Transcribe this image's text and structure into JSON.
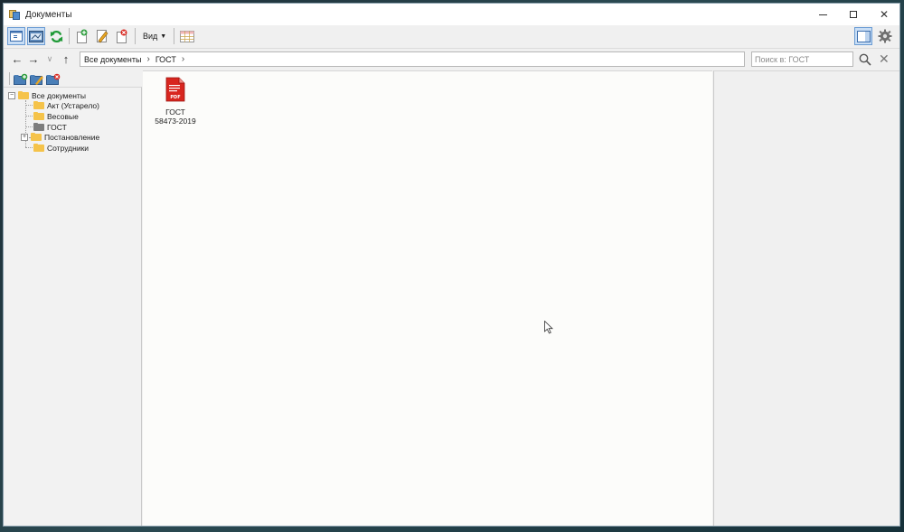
{
  "window": {
    "title": "Документы",
    "controls": {
      "minimize": "—",
      "maximize": "☐",
      "close": "✕"
    }
  },
  "toolbar": {
    "view_label": "Вид",
    "buttons": [
      "panel-toggle-icon",
      "view-layout-icon",
      "refresh-icon",
      "add-document-icon",
      "edit-icon",
      "delete-document-icon"
    ],
    "right_buttons": [
      "preview-pane-icon",
      "settings-gear-icon"
    ]
  },
  "address": {
    "breadcrumb": [
      "Все документы",
      "ГОСТ"
    ],
    "separator": "›",
    "search_placeholder": "Поиск в: ГОСТ"
  },
  "tree": {
    "root": "Все документы",
    "items": [
      {
        "label": "Акт (Устарело)",
        "color": "#f5c34a",
        "expandable": false
      },
      {
        "label": "Весовые",
        "color": "#f5c34a",
        "expandable": false
      },
      {
        "label": "ГОСТ",
        "color": "#7d7d7d",
        "expandable": false,
        "selected": true
      },
      {
        "label": "Постановление",
        "color": "#f5c34a",
        "expandable": true
      },
      {
        "label": "Сотрудники",
        "color": "#f5c34a",
        "expandable": false
      }
    ]
  },
  "content": {
    "files": [
      {
        "name_line1": "ГОСТ",
        "name_line2": "58473-2019",
        "type": "pdf",
        "icon_text": "PDF"
      }
    ]
  },
  "colors": {
    "accent": "#4f8ccf",
    "folder": "#f5c34a",
    "selected_folder": "#7d7d7d",
    "pdf_red": "#d8261f"
  }
}
